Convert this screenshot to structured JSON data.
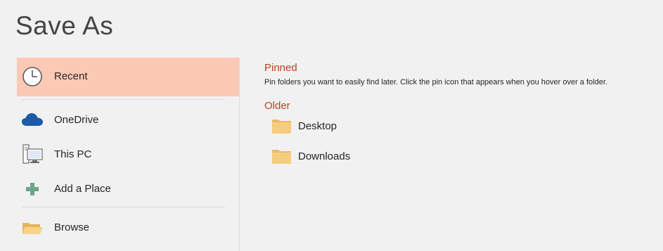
{
  "title": "Save As",
  "nav": {
    "recent": "Recent",
    "onedrive": "OneDrive",
    "thispc": "This PC",
    "addplace": "Add a Place",
    "browse": "Browse"
  },
  "pinned": {
    "heading": "Pinned",
    "hint": "Pin folders you want to easily find later. Click the pin icon that appears when you hover over a folder."
  },
  "older": {
    "heading": "Older",
    "folders": [
      "Desktop",
      "Downloads"
    ]
  },
  "colors": {
    "accent": "#c43e1c",
    "selected_bg": "#fcc9b4",
    "folder": "#f2cc7a"
  }
}
